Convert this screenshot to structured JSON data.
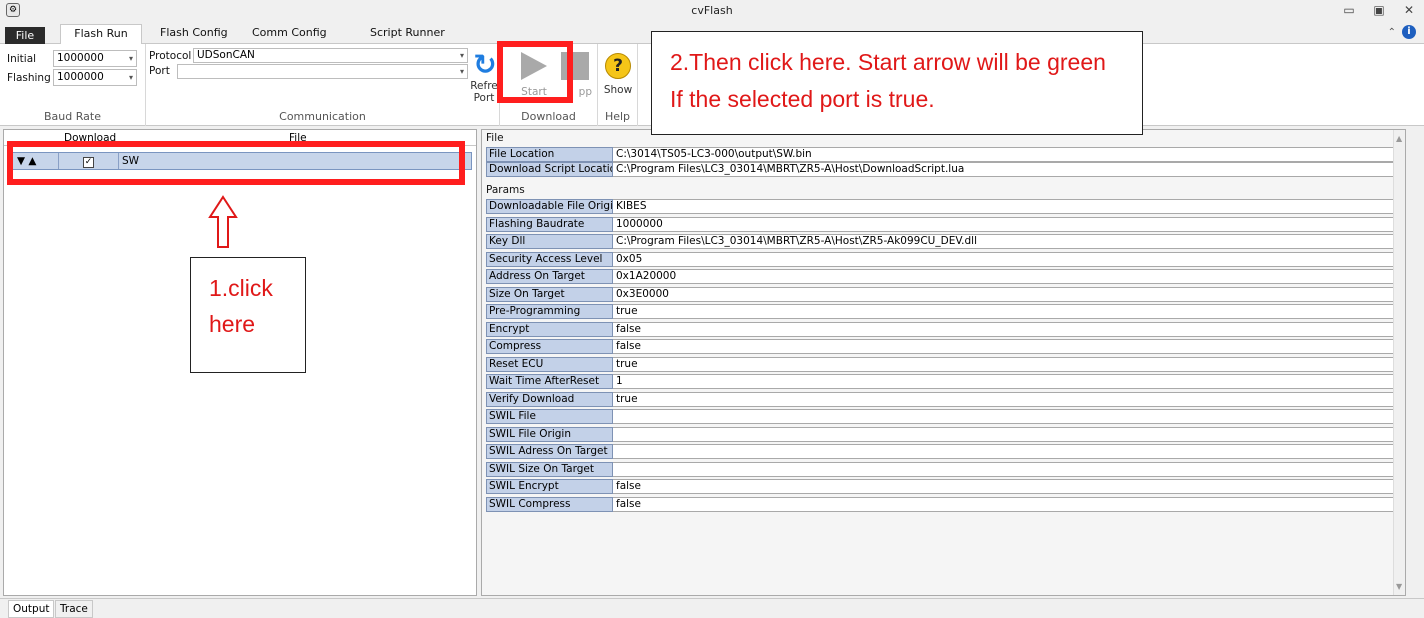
{
  "window": {
    "title": "cvFlash"
  },
  "tabs": {
    "file": "File",
    "flash_run": "Flash Run",
    "flash_config": "Flash Config",
    "comm_config": "Comm Config",
    "script_runner": "Script Runner"
  },
  "baud": {
    "initial_label": "Initial",
    "initial_value": "1000000",
    "flashing_label": "Flashing",
    "flashing_value": "1000000",
    "group_label": "Baud Rate"
  },
  "comm": {
    "protocol_label": "Protocol",
    "protocol_value": "UDSonCAN",
    "port_label": "Port",
    "port_value": "",
    "refresh_label_1": "Refre",
    "refresh_label_2": "Port",
    "group_label": "Communication"
  },
  "download": {
    "start_label": "Start",
    "stop_label": "pp",
    "group_label": "Download"
  },
  "help": {
    "show_label": "Show",
    "group_label": "Help"
  },
  "annotations": {
    "note2": "2.Then click here. Start arrow will be green If the selected port is true.",
    "note1": "1.click here"
  },
  "grid": {
    "col_download": "Download",
    "col_file": "File",
    "rows": [
      {
        "expand": "▼ ▲",
        "checked": "✓",
        "name": "SW"
      }
    ]
  },
  "file_section": {
    "label": "File",
    "rows": [
      {
        "key": "File Location",
        "value": "C:\\3014\\TS05-LC3-000\\output\\SW.bin"
      },
      {
        "key": "Download Script Location",
        "value": "C:\\Program Files\\LC3_03014\\MBRT\\ZR5-A\\Host\\DownloadScript.lua"
      }
    ]
  },
  "params_section": {
    "label": "Params",
    "rows": [
      {
        "key": "Downloadable File Origin",
        "value": "KIBES"
      },
      {
        "key": "Flashing Baudrate",
        "value": "1000000"
      },
      {
        "key": "Key Dll",
        "value": "C:\\Program Files\\LC3_03014\\MBRT\\ZR5-A\\Host\\ZR5-Ak099CU_DEV.dll"
      },
      {
        "key": "Security Access Level",
        "value": "0x05"
      },
      {
        "key": "Address On Target",
        "value": "0x1A20000"
      },
      {
        "key": "Size On Target",
        "value": "0x3E0000"
      },
      {
        "key": "Pre-Programming",
        "value": "true"
      },
      {
        "key": "Encrypt",
        "value": "false"
      },
      {
        "key": "Compress",
        "value": "false"
      },
      {
        "key": "Reset ECU",
        "value": "true"
      },
      {
        "key": "Wait Time AfterReset",
        "value": "1"
      },
      {
        "key": "Verify Download",
        "value": "true"
      },
      {
        "key": "SWIL File",
        "value": ""
      },
      {
        "key": "SWIL File Origin",
        "value": ""
      },
      {
        "key": "SWIL Adress On Target",
        "value": ""
      },
      {
        "key": "SWIL Size On Target",
        "value": ""
      },
      {
        "key": "SWIL Encrypt",
        "value": "false"
      },
      {
        "key": "SWIL Compress",
        "value": "false"
      }
    ]
  },
  "bottom_tabs": {
    "output": "Output",
    "trace": "Trace"
  }
}
